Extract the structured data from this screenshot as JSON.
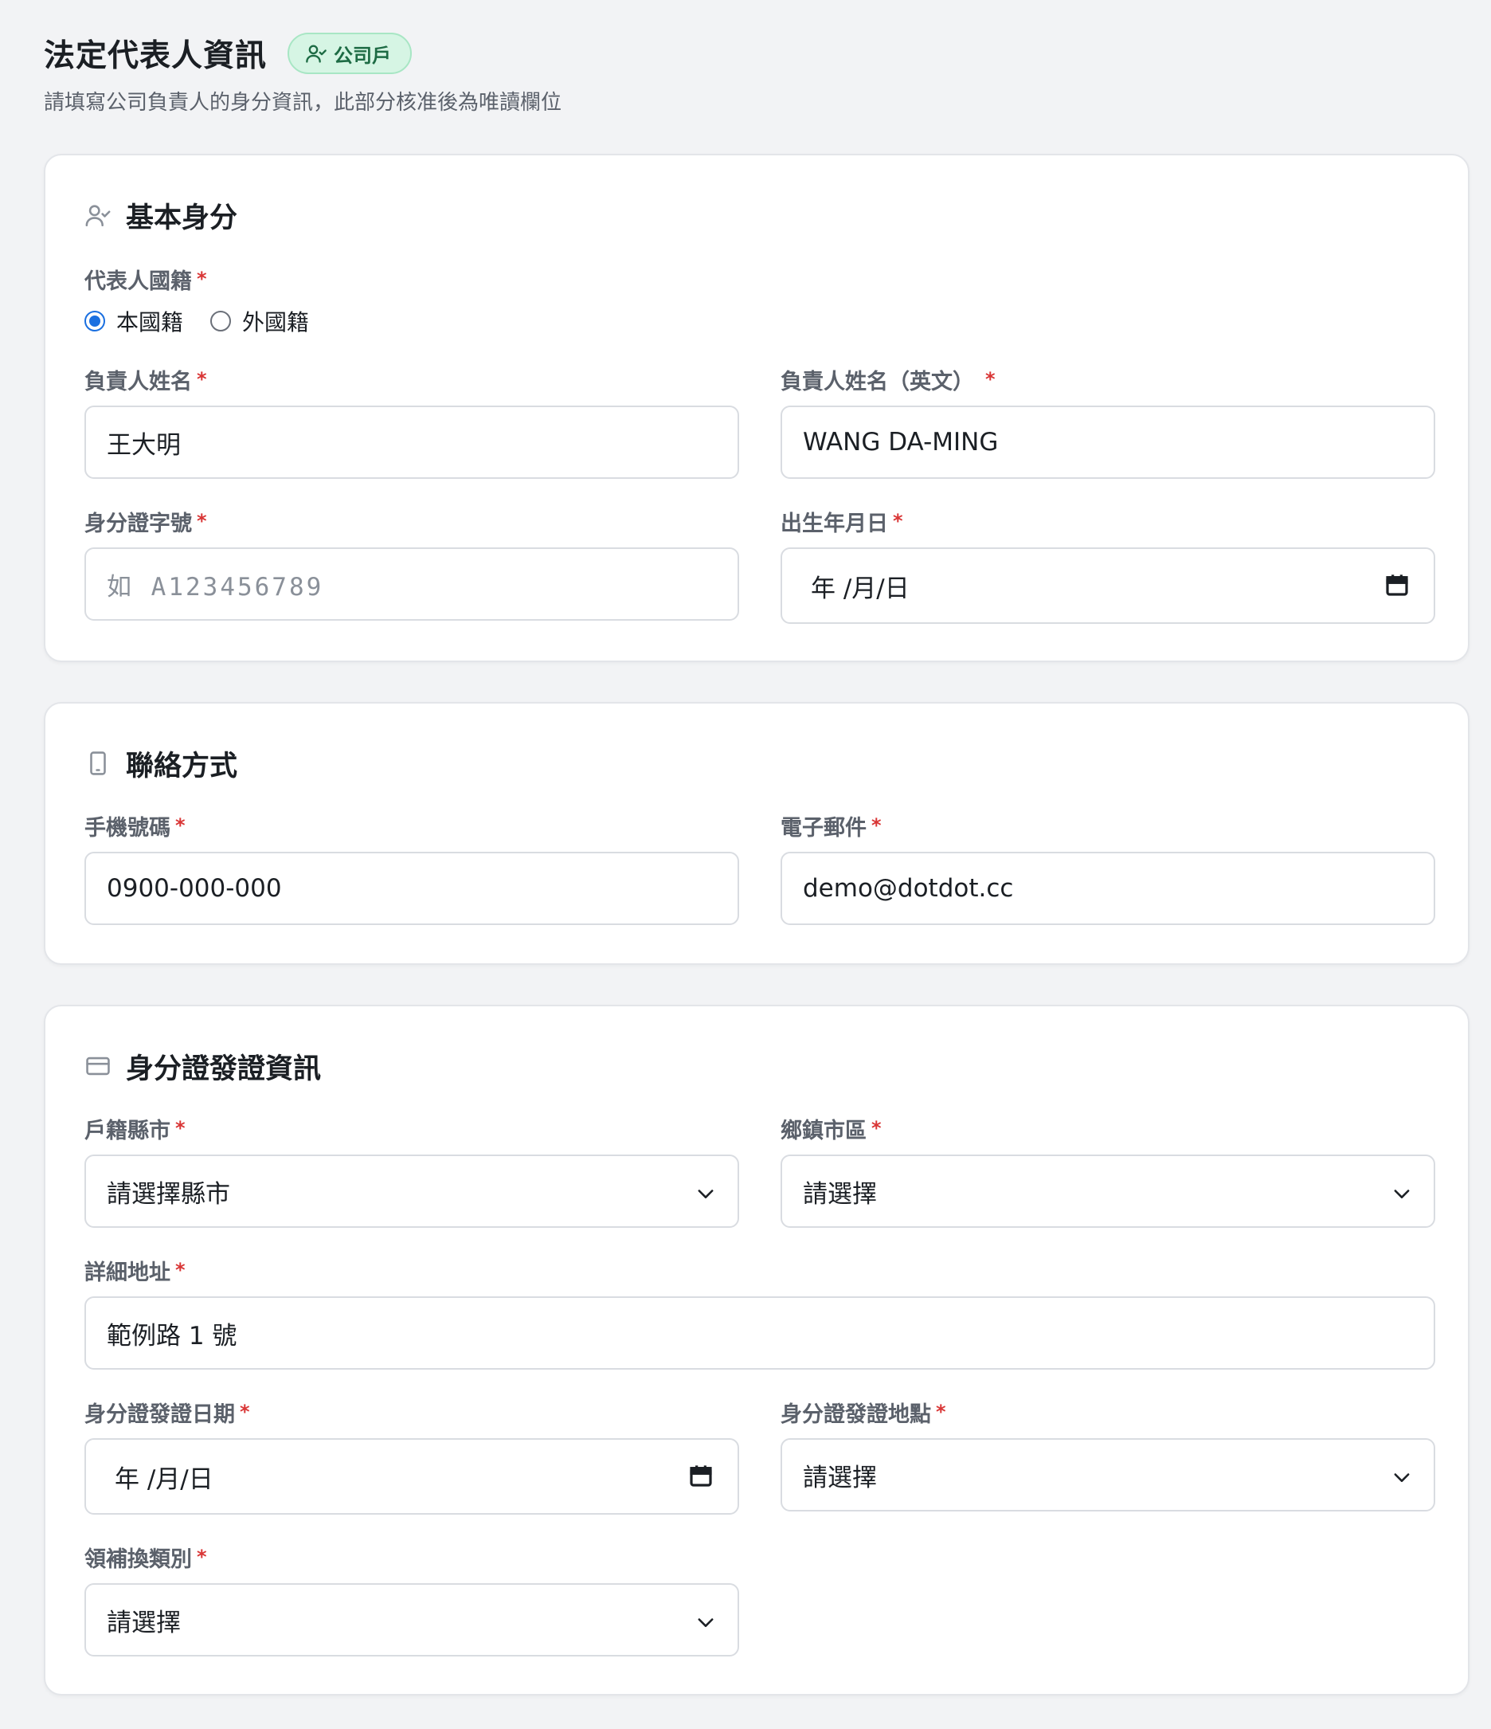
{
  "header": {
    "title": "法定代表人資訊",
    "badge": "公司戶",
    "subtitle": "請填寫公司負責人的身分資訊，此部分核准後為唯讀欄位"
  },
  "basic": {
    "title": "基本身分",
    "nationality_label": "代表人國籍",
    "nationality_options": [
      "本國籍",
      "外國籍"
    ],
    "nationality_selected": "本國籍",
    "name_label": "負責人姓名",
    "name_value": "王大明",
    "name_en_label": "負責人姓名（英文）",
    "name_en_value": "WANG DA-MING",
    "id_label": "身分證字號",
    "id_placeholder": "如 A123456789",
    "dob_label": "出生年月日",
    "dob_value": "年 /月/日"
  },
  "contact": {
    "title": "聯絡方式",
    "phone_label": "手機號碼",
    "phone_value": "0900-000-000",
    "email_label": "電子郵件",
    "email_value": "demo@dotdot.cc"
  },
  "id_issue": {
    "title": "身分證發證資訊",
    "city_label": "戶籍縣市",
    "city_value": "請選擇縣市",
    "district_label": "鄉鎮市區",
    "district_value": "請選擇",
    "address_label": "詳細地址",
    "address_value": "範例路 1 號",
    "issue_date_label": "身分證發證日期",
    "issue_date_value": "年 /月/日",
    "issue_place_label": "身分證發證地點",
    "issue_place_value": "請選擇",
    "reissue_label": "領補換類別",
    "reissue_value": "請選擇"
  },
  "required_mark": "*",
  "colors": {
    "accent": "#1a6fe0",
    "required": "#d93636",
    "badge_bg": "#d6f5e4",
    "badge_text": "#1d6b44"
  },
  "icons": {
    "badge": "user-check-icon",
    "basic": "user-check-icon",
    "contact": "smartphone-icon",
    "id_issue": "credit-card-icon"
  }
}
